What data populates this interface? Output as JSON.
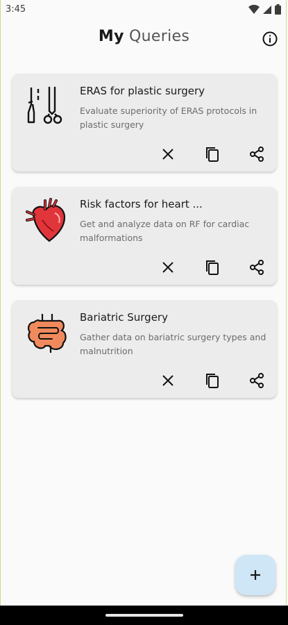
{
  "status_bar": {
    "time": "3:45",
    "icons": [
      "wifi-icon",
      "signal-icon",
      "battery-icon"
    ]
  },
  "header": {
    "title_bold": "My",
    "title_rest": "Queries",
    "info_icon": "info-icon"
  },
  "queries": [
    {
      "icon": "surgical-tools-icon",
      "title": "ERAS for plastic surgery",
      "description": "Evaluate superiority of ERAS protocols in plastic surgery"
    },
    {
      "icon": "heart-icon",
      "title": "Risk factors for heart ...",
      "description": "Get and analyze data on RF for cardiac malformations"
    },
    {
      "icon": "intestine-icon",
      "title": "Bariatric Surgery",
      "description": "Gather data on bariatric surgery types and malnutrition"
    }
  ],
  "actions": [
    "close-icon",
    "copy-icon",
    "share-icon"
  ],
  "fab": {
    "icon": "plus-icon",
    "label": "+",
    "color": "#cfe6f7"
  }
}
